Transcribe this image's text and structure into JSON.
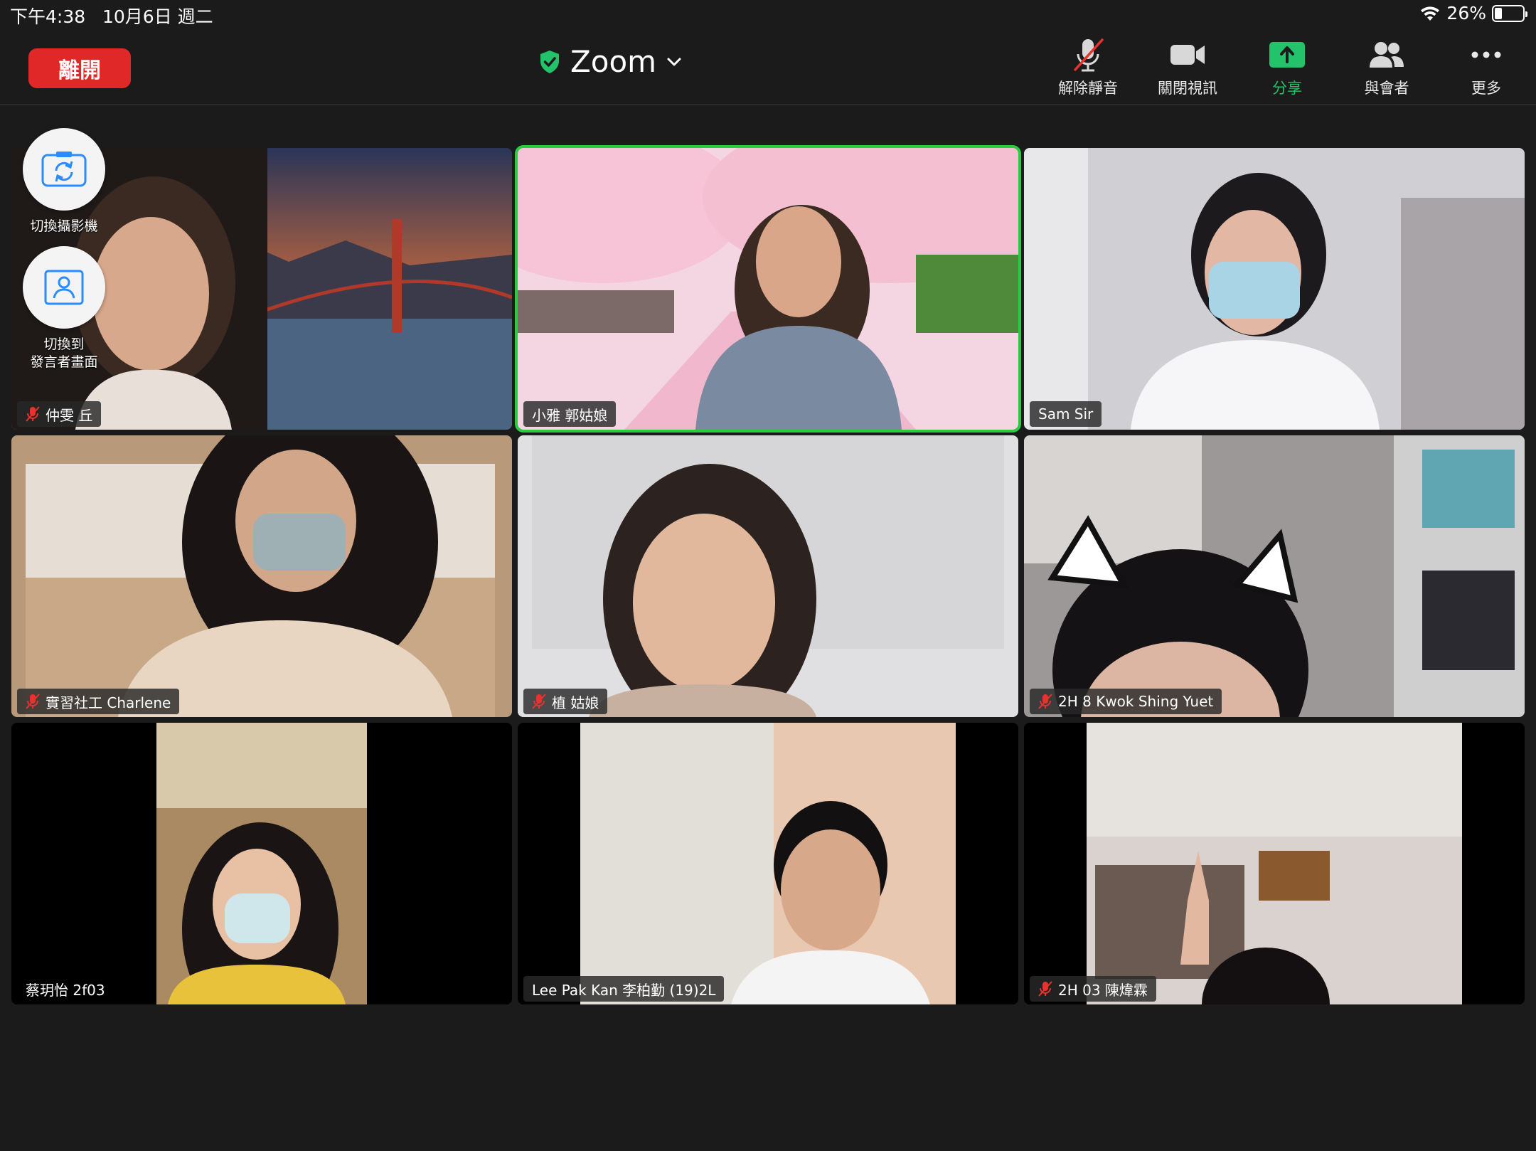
{
  "status": {
    "time": "下午4:38",
    "date": "10月6日 週二",
    "battery_percent_label": "26%",
    "battery_level": 0.26
  },
  "topbar": {
    "leave_label": "離開",
    "meeting_title": "Zoom",
    "toolbar": [
      {
        "label": "解除靜音",
        "icon": "mic-muted-icon"
      },
      {
        "label": "關閉視訊",
        "icon": "video-camera-icon"
      },
      {
        "label": "分享",
        "icon": "share-screen-icon"
      },
      {
        "label": "與會者",
        "icon": "participants-icon"
      },
      {
        "label": "更多",
        "icon": "more-icon"
      }
    ]
  },
  "floating": {
    "switch_camera_label": "切換攝影機",
    "switch_speaker_label_1": "切換到",
    "switch_speaker_label_2": "發言者畫面"
  },
  "participants": [
    {
      "name": "仲雯 丘",
      "muted": true
    },
    {
      "name": "小雅 郭姑娘",
      "muted": false,
      "active_speaker": true
    },
    {
      "name": "Sam Sir",
      "muted": false
    },
    {
      "name": "實習社工 Charlene",
      "muted": true
    },
    {
      "name": "植 姑娘",
      "muted": true
    },
    {
      "name": "2H 8 Kwok Shing Yuet",
      "muted": true
    },
    {
      "name": "蔡玥怡 2f03",
      "muted": false
    },
    {
      "name": "Lee Pak Kan 李柏勤 (19)2L",
      "muted": false
    },
    {
      "name": "2H 03 陳煒霖",
      "muted": true
    }
  ],
  "colors": {
    "leave": "#e02828",
    "active_border": "#27cc3f",
    "share": "#22c36a",
    "muted": "#e8322e"
  }
}
